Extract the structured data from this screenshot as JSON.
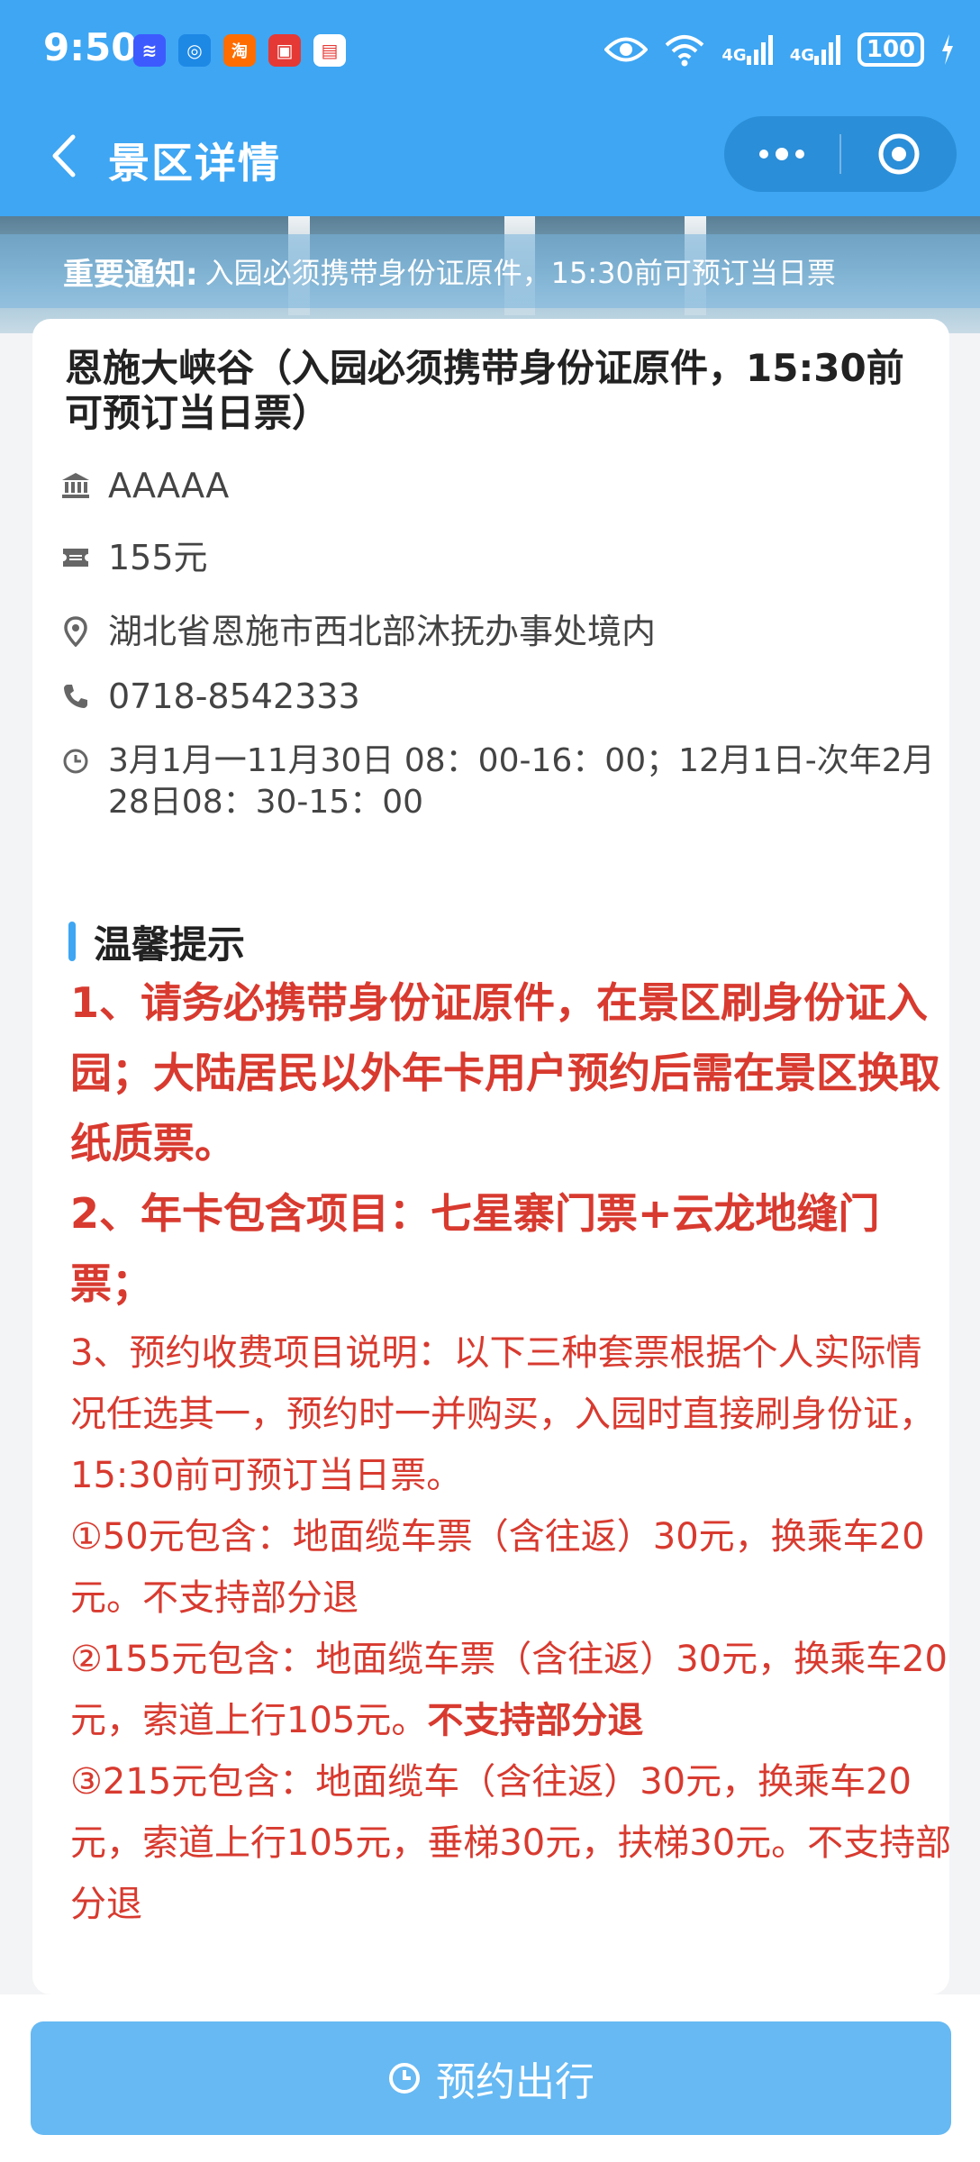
{
  "status_bar": {
    "time": "9:50",
    "app_icons": [
      {
        "name": "voice-app-icon",
        "color": "#3d5afe",
        "glyph": "≋"
      },
      {
        "name": "browser-app-icon",
        "color": "#1e88e5",
        "glyph": "◎"
      },
      {
        "name": "taobao-app-icon",
        "color": "#ff6d00",
        "glyph": "淘"
      },
      {
        "name": "book-app-icon",
        "color": "#e53935",
        "glyph": "▣"
      },
      {
        "name": "calendar-app-icon",
        "color": "#e53935",
        "glyph": "▤"
      }
    ],
    "network_1": "4G",
    "network_2": "4G",
    "battery": "100"
  },
  "nav": {
    "title": "景区详情"
  },
  "notice": {
    "head": "重要通知:",
    "text": "入园必须携带身份证原件，15:30前可预订当日票"
  },
  "scenic": {
    "title": "恩施大峡谷（入园必须携带身份证原件，15:30前可预订当日票）",
    "level": "AAAAA",
    "price": "155元",
    "address": "湖北省恩施市西北部沐抚办事处境内",
    "phone": "0718-8542333",
    "hours": "3月1月一11月30日 08：00-16：00；12月1日-次年2月28日08：30-15：00"
  },
  "tips": {
    "title": "温馨提示",
    "line1": "1、请务必携带身份证原件，在景区刷身份证入园；大陆居民以外年卡用户预约后需在景区换取纸质票。",
    "line2": "2、年卡包含项目：七星寨门票+云龙地缝门票；",
    "line3": "3、预约收费项目说明：以下三种套票根据个人实际情况任选其一，预约时一并购买，入园时直接刷身份证，15:30前可预订当日票。",
    "line4": "①50元包含：地面缆车票（含往返）30元，换乘车20元。不支持部分退",
    "line5a": "②155元包含：地面缆车票（含往返）30元，换乘车20元，索道上行105元。",
    "line5b": "不支持部分退",
    "line6": "③215元包含：地面缆车（含往返）30元，换乘车20元，索道上行105元，垂梯30元，扶梯30元。不支持部分退"
  },
  "footer": {
    "reserve_label": "预约出行"
  },
  "colors": {
    "primary": "#3ea6f3",
    "button": "#66b9f3",
    "tip_red": "#d83a2f"
  }
}
